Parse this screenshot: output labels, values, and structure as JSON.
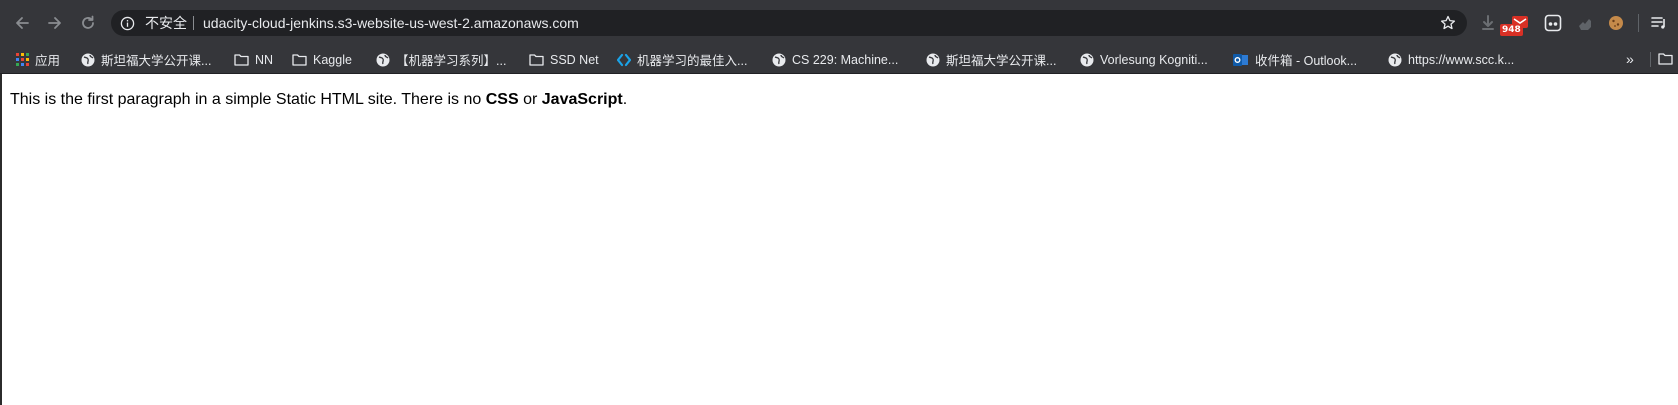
{
  "browser": {
    "security_label": "不安全",
    "url": "udacity-cloud-jenkins.s3-website-us-west-2.amazonaws.com",
    "extension_badge_count": "948"
  },
  "bookmarks": {
    "items": [
      {
        "label": "应用",
        "icon": "apps-grid-icon"
      },
      {
        "label": "斯坦福大学公开课...",
        "icon": "globe-icon"
      },
      {
        "label": "NN",
        "icon": "folder-icon"
      },
      {
        "label": "Kaggle",
        "icon": "folder-icon"
      },
      {
        "label": "【机器学习系列】...",
        "icon": "globe-icon"
      },
      {
        "label": "SSD Net",
        "icon": "folder-icon"
      },
      {
        "label": "机器学习的最佳入...",
        "icon": "diamond-icon"
      },
      {
        "label": "CS 229: Machine...",
        "icon": "globe-icon"
      },
      {
        "label": "斯坦福大学公开课...",
        "icon": "globe-icon"
      },
      {
        "label": "Vorlesung Kogniti...",
        "icon": "globe-icon"
      },
      {
        "label": "收件箱 - Outlook...",
        "icon": "outlook-icon"
      },
      {
        "label": "https://www.scc.k...",
        "icon": "globe-icon"
      }
    ],
    "overflow_label": "»"
  },
  "page": {
    "paragraph_pre": "This is the first paragraph in a simple Static HTML site. There is no ",
    "strong_1": "CSS",
    "paragraph_mid": " or ",
    "strong_2": "JavaScript",
    "paragraph_post": "."
  },
  "colors": {
    "toolbar_bg": "#35363a",
    "omnibox_bg": "#202124",
    "text_light": "#e8eaed",
    "badge_red": "#d93025"
  }
}
